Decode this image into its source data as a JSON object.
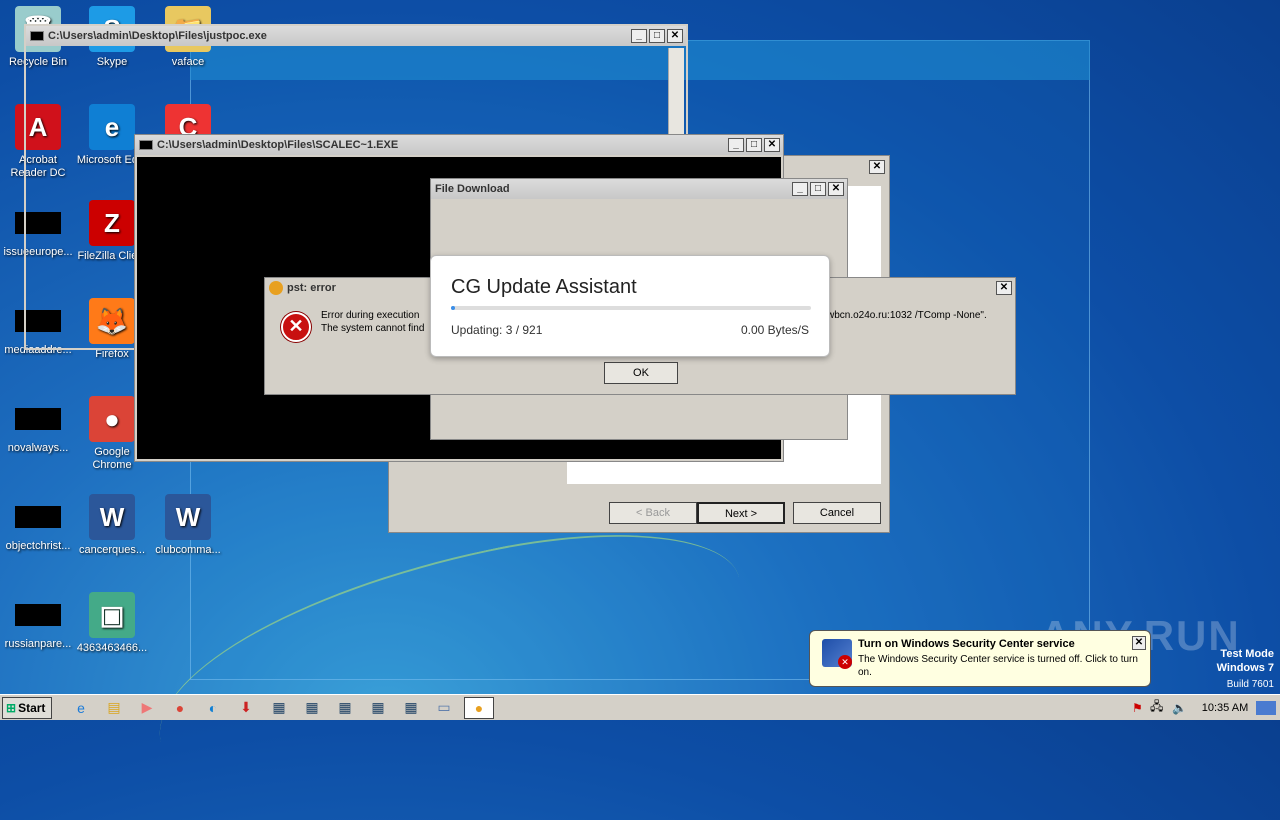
{
  "desktop_icons": [
    {
      "label": "Recycle Bin",
      "glyph": "🗑",
      "color": "#9cc"
    },
    {
      "label": "Skype",
      "glyph": "S",
      "color": "#1d9be6"
    },
    {
      "label": "vaface",
      "glyph": "📁",
      "color": "#e8c860"
    },
    {
      "label": "Acrobat Reader DC",
      "glyph": "A",
      "color": "#d0111b"
    },
    {
      "label": "Microsoft Ed...",
      "glyph": "e",
      "color": "#0f7fd4"
    },
    {
      "label": "CCleaner",
      "glyph": "C",
      "color": "#e33"
    },
    {
      "label": "issueeurope...",
      "glyph": "",
      "color": "#000"
    },
    {
      "label": "FileZilla Client",
      "glyph": "Z",
      "color": "#c00"
    },
    {
      "label": "mediaaddre...",
      "glyph": "",
      "color": "#000"
    },
    {
      "label": "Firefox",
      "glyph": "🦊",
      "color": "#ff7a18"
    },
    {
      "label": "novalways...",
      "glyph": "",
      "color": "#000"
    },
    {
      "label": "Google Chrome",
      "glyph": "●",
      "color": "#db4437"
    },
    {
      "label": "objectchrist...",
      "glyph": "",
      "color": "#000"
    },
    {
      "label": "cancerques...",
      "glyph": "W",
      "color": "#2b579a"
    },
    {
      "label": "clubcomma...",
      "glyph": "W",
      "color": "#2b579a"
    },
    {
      "label": "russianpare...",
      "glyph": "",
      "color": "#000"
    },
    {
      "label": "4363463466...",
      "glyph": "▣",
      "color": "#4a8"
    }
  ],
  "win_justpoc": {
    "title": "C:\\Users\\admin\\Desktop\\Files\\justpoc.exe"
  },
  "win_scalec": {
    "title": "C:\\Users\\admin\\Desktop\\Files\\SCALEC~1.EXE"
  },
  "win_download": {
    "title": "File Download"
  },
  "win_wizard": {
    "back": "< Back",
    "next": "Next >",
    "cancel": "Cancel"
  },
  "win_error": {
    "title": "pst: error",
    "line1": "Error during execution",
    "line2": "The system cannot find",
    "tail": "wbcn.o24o.ru:1032 /TComp -None\".",
    "ok": "OK"
  },
  "cg": {
    "title": "CG Update Assistant",
    "status": "Updating: 3 / 921",
    "speed": "0.00 Bytes/S",
    "progress": 0.003
  },
  "balloon": {
    "title": "Turn on Windows Security Center service",
    "body": "The Windows Security Center service is turned off. Click to turn on."
  },
  "watermark": {
    "mode": "Test Mode",
    "os": "Windows 7",
    "build": "Build 7601"
  },
  "taskbar": {
    "start": "Start",
    "clock": "10:35 AM"
  },
  "anyrun": "ANY.RUN"
}
